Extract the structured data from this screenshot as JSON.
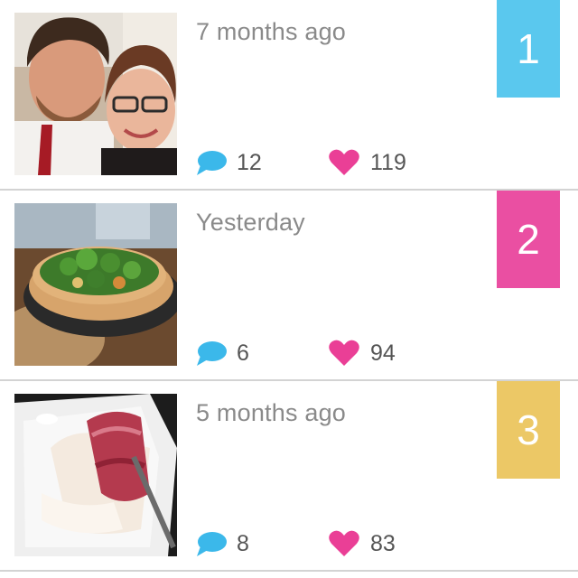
{
  "colors": {
    "comment_icon": "#3bb8ea",
    "heart_icon": "#ea3f96",
    "divider": "#d3d3d3",
    "time_text": "#8a8a8a",
    "count_text": "#555555"
  },
  "posts": [
    {
      "time": "7 months ago",
      "rank": "1",
      "rank_color": "#5ac8ee",
      "comments": "12",
      "likes": "119",
      "photo": "couple-selfie"
    },
    {
      "time": "Yesterday",
      "rank": "2",
      "rank_color": "#ea4fa2",
      "comments": "6",
      "likes": "94",
      "photo": "broccoli-quiche"
    },
    {
      "time": "5 months ago",
      "rank": "3",
      "rank_color": "#ecc866",
      "comments": "8",
      "likes": "83",
      "photo": "berry-cake-slice"
    }
  ]
}
